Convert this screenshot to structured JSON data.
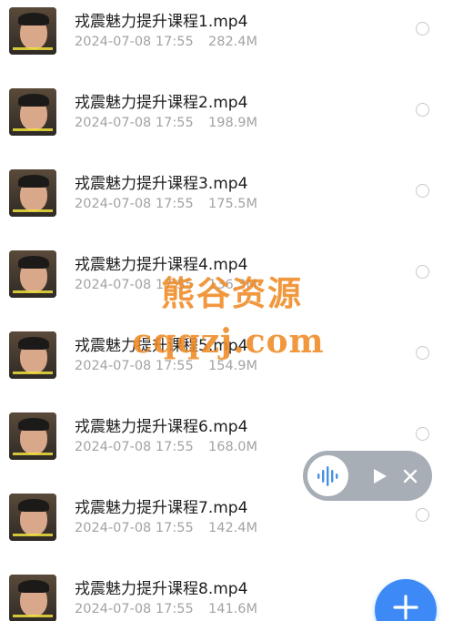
{
  "files": [
    {
      "name": "戎震魅力提升课程1.mp4",
      "date": "2024-07-08 17:55",
      "size": "282.4M"
    },
    {
      "name": "戎震魅力提升课程2.mp4",
      "date": "2024-07-08 17:55",
      "size": "198.9M"
    },
    {
      "name": "戎震魅力提升课程3.mp4",
      "date": "2024-07-08 17:55",
      "size": "175.5M"
    },
    {
      "name": "戎震魅力提升课程4.mp4",
      "date": "2024-07-08 17:55",
      "size": "136.3M"
    },
    {
      "name": "戎震魅力提升课程5.mp4",
      "date": "2024-07-08 17:55",
      "size": "154.9M"
    },
    {
      "name": "戎震魅力提升课程6.mp4",
      "date": "2024-07-08 17:55",
      "size": "168.0M"
    },
    {
      "name": "戎震魅力提升课程7.mp4",
      "date": "2024-07-08 17:55",
      "size": "142.4M"
    },
    {
      "name": "戎震魅力提升课程8.mp4",
      "date": "2024-07-08 17:55",
      "size": "141.6M"
    }
  ],
  "watermark": {
    "line1": "熊谷资源",
    "line2": "cqqzj.com"
  },
  "player": {
    "wave_icon": "audio-wave-icon",
    "play_icon": "play-icon",
    "close_icon": "close-icon"
  },
  "fab": {
    "icon": "plus-icon"
  },
  "colors": {
    "accent": "#3d8af7",
    "watermark": "#f08a24",
    "meta_text": "#a3a3a3",
    "pill_bg": "#a7aeb6"
  }
}
